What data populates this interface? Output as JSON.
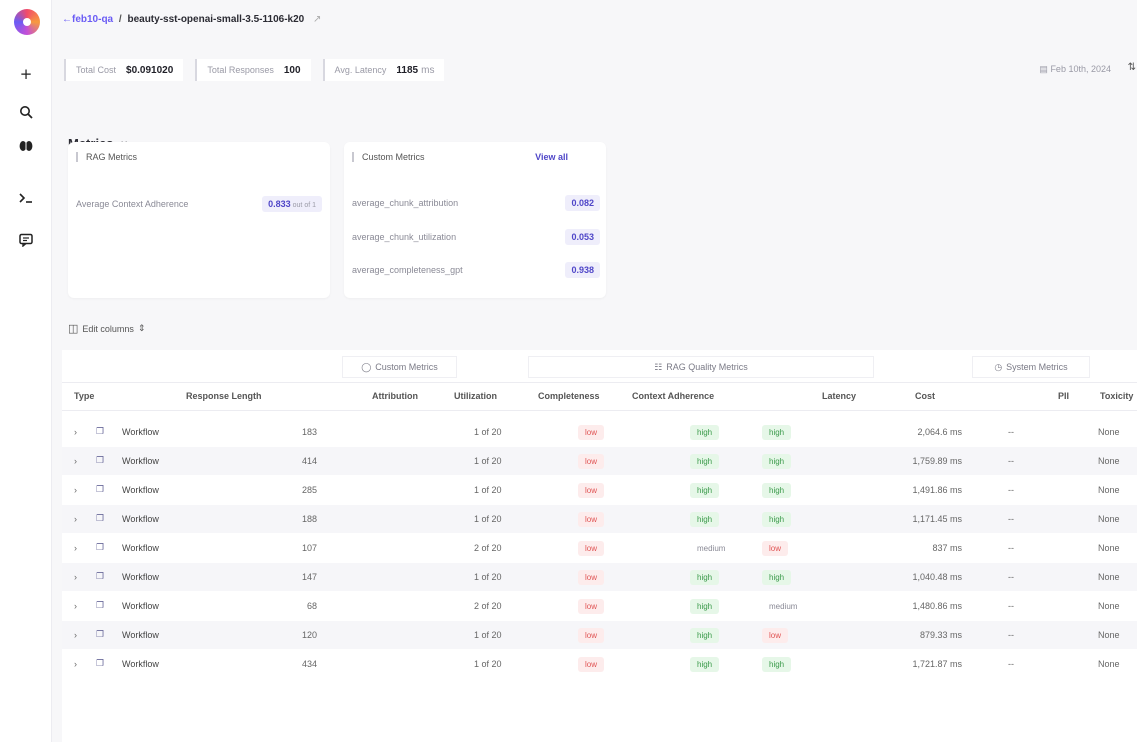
{
  "rail": {
    "icons": [
      "logo",
      "plus-icon",
      "search-icon",
      "brain-icon",
      "terminal-icon",
      "feedback-icon"
    ]
  },
  "breadcrumb": {
    "back": "←feb10-qa",
    "separator": "/",
    "current": "beauty-sst-openai-small-3.5-1106-k20",
    "external_glyph": "↗"
  },
  "stats": {
    "total_cost_label": "Total Cost",
    "total_cost_value": "$0.091020",
    "total_responses_label": "Total Responses",
    "total_responses_value": "100",
    "avg_latency_label": "Avg. Latency",
    "avg_latency_value": "1185",
    "avg_latency_unit": "ms",
    "date": "Feb 10th, 2024"
  },
  "metrics": {
    "title": "Metrics",
    "chevron": "∨",
    "rag_card": {
      "title": "RAG Metrics",
      "rows": [
        {
          "name": "Average Context Adherence",
          "value": "0.833",
          "suffix": "out of 1"
        }
      ]
    },
    "custom_card": {
      "title": "Custom Metrics",
      "view_all": "View all",
      "rows": [
        {
          "name": "average_chunk_attribution",
          "value": "0.082"
        },
        {
          "name": "average_chunk_utilization",
          "value": "0.053"
        },
        {
          "name": "average_completeness_gpt",
          "value": "0.938"
        }
      ]
    }
  },
  "table": {
    "edit_columns_label": "Edit columns",
    "groups": {
      "custom": "Custom Metrics",
      "rag": "RAG Quality Metrics",
      "system": "System Metrics"
    },
    "columns": {
      "type": "Type",
      "response_length": "Response Length",
      "attribution": "Attribution",
      "utilization": "Utilization",
      "completeness": "Completeness",
      "context_adherence": "Context Adherence",
      "latency": "Latency",
      "cost": "Cost",
      "pii": "PII",
      "toxicity": "Toxicity"
    },
    "rows": [
      {
        "type": "Workflow",
        "length": "183",
        "utilization": "1 of 20",
        "completeness": "low",
        "adherence": "high",
        "extra": "high",
        "latency": "2,064.6 ms",
        "cost": "--",
        "toxicity": "None"
      },
      {
        "type": "Workflow",
        "length": "414",
        "utilization": "1 of 20",
        "completeness": "low",
        "adherence": "high",
        "extra": "high",
        "latency": "1,759.89 ms",
        "cost": "--",
        "toxicity": "None"
      },
      {
        "type": "Workflow",
        "length": "285",
        "utilization": "1 of 20",
        "completeness": "low",
        "adherence": "high",
        "extra": "high",
        "latency": "1,491.86 ms",
        "cost": "--",
        "toxicity": "None"
      },
      {
        "type": "Workflow",
        "length": "188",
        "utilization": "1 of 20",
        "completeness": "low",
        "adherence": "high",
        "extra": "high",
        "latency": "1,171.45 ms",
        "cost": "--",
        "toxicity": "None"
      },
      {
        "type": "Workflow",
        "length": "107",
        "utilization": "2 of 20",
        "completeness": "low",
        "adherence": "medium",
        "extra": "low",
        "latency": "837 ms",
        "cost": "--",
        "toxicity": "None"
      },
      {
        "type": "Workflow",
        "length": "147",
        "utilization": "1 of 20",
        "completeness": "low",
        "adherence": "high",
        "extra": "high",
        "latency": "1,040.48 ms",
        "cost": "--",
        "toxicity": "None"
      },
      {
        "type": "Workflow",
        "length": "68",
        "utilization": "2 of 20",
        "completeness": "low",
        "adherence": "high",
        "extra": "medium",
        "latency": "1,480.86 ms",
        "cost": "--",
        "toxicity": "None"
      },
      {
        "type": "Workflow",
        "length": "120",
        "utilization": "1 of 20",
        "completeness": "low",
        "adherence": "high",
        "extra": "low",
        "latency": "879.33 ms",
        "cost": "--",
        "toxicity": "None"
      },
      {
        "type": "Workflow",
        "length": "434",
        "utilization": "1 of 20",
        "completeness": "low",
        "adherence": "high",
        "extra": "high",
        "latency": "1,721.87 ms",
        "cost": "--",
        "toxicity": "None"
      }
    ]
  }
}
